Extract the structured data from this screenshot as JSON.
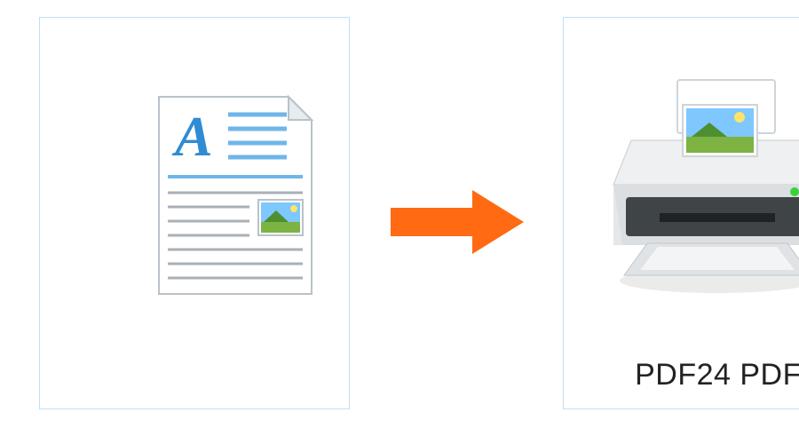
{
  "colors": {
    "panel_border": "#bfe0f7",
    "arrow": "#ff6a13",
    "doc_outline": "#b9c2c8",
    "doc_line_accent": "#6fb6e8",
    "doc_line_muted": "#a9b0b6",
    "doc_letter": "#2f8cd3",
    "printer_body_light": "#e6e7e8",
    "printer_body_dark": "#b4b8bb",
    "printer_face": "#3f4447",
    "printer_led": "#3ad23a",
    "photo_sky": "#7ec7ff",
    "photo_land": "#7cb342",
    "photo_sun": "#ffe36b"
  },
  "left_panel": {
    "icon": "document-icon"
  },
  "arrow": {
    "icon": "arrow-right-icon"
  },
  "right_panel": {
    "icon": "printer-icon",
    "caption": "PDF24 PDF"
  }
}
